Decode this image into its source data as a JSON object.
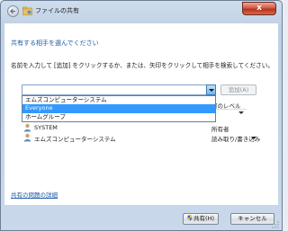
{
  "window": {
    "title": "ファイルの共有",
    "close_label": "x"
  },
  "main": {
    "heading": "共有する相手を選んでください",
    "instruction": "名前を入力して [追加] をクリックするか、または、矢印をクリックして相手を検索してください。",
    "combo_value": "",
    "add_button": "追加(A)",
    "dropdown_options": [
      "エムズコンピューターシステム",
      "Everyone",
      "ホームグループ"
    ],
    "permission_header": "可のレベル",
    "rows": [
      {
        "name": "SYSTEM",
        "permission": "所有者"
      },
      {
        "name": "エムズコンピューターシステム",
        "permission": "読み取り/書き込み"
      }
    ],
    "help_link": "共有の問題の詳細"
  },
  "footer": {
    "share_button": "共有(H)",
    "cancel_button": "キャンセル"
  },
  "colors": {
    "link": "#1e5aa8",
    "selection": "#3399ff",
    "close": "#c8442d"
  },
  "icons": {
    "back": "back-arrow-icon",
    "title": "folder-share-icon",
    "user": "user-icon",
    "shield": "uac-shield-icon",
    "grip": "resize-grip-icon"
  }
}
